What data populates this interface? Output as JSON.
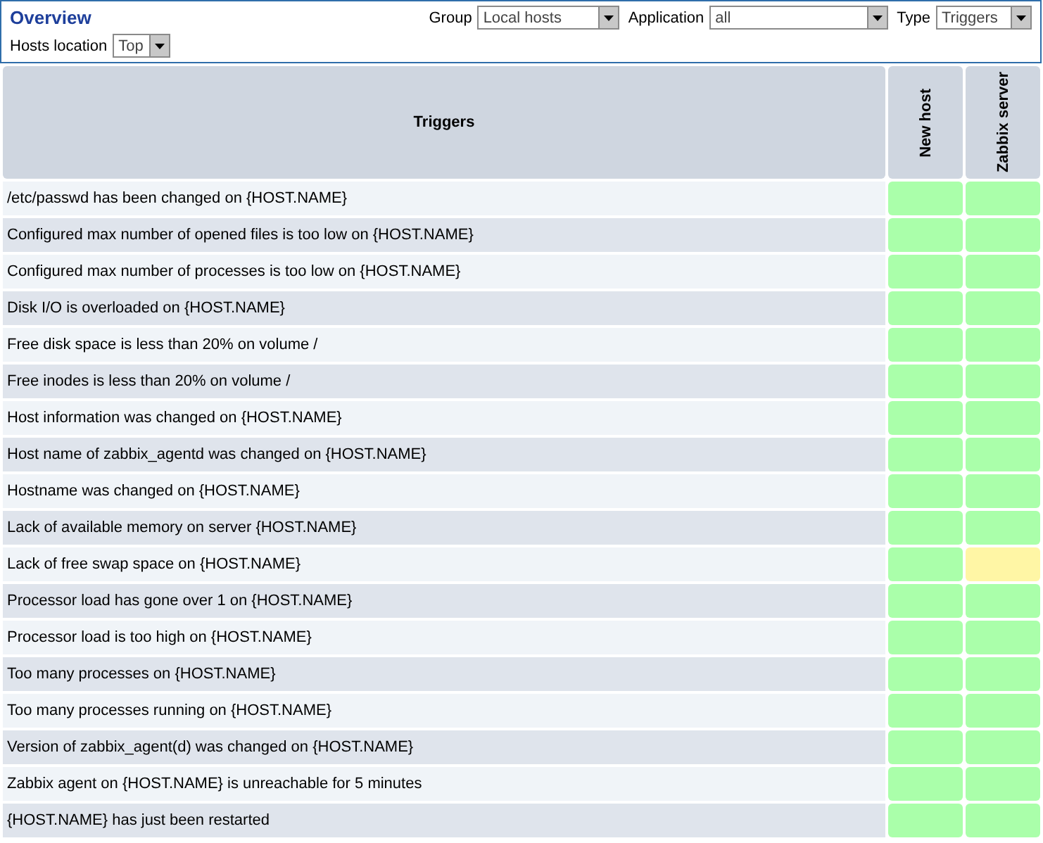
{
  "header": {
    "title": "Overview",
    "filters": [
      {
        "label": "Group",
        "value": "Local hosts"
      },
      {
        "label": "Application",
        "value": "all"
      },
      {
        "label": "Type",
        "value": "Triggers"
      }
    ],
    "second_filters": [
      {
        "label": "Hosts location",
        "value": "Top"
      }
    ]
  },
  "table": {
    "columns": [
      "Triggers",
      "New host",
      "Zabbix server"
    ],
    "rows": [
      {
        "trigger": "/etc/passwd has been changed on {HOST.NAME}",
        "cells": [
          {
            "color": "#aaffaa"
          },
          {
            "color": "#aaffaa"
          }
        ]
      },
      {
        "trigger": "Configured max number of opened files is too low on {HOST.NAME}",
        "cells": [
          {
            "color": "#aaffaa"
          },
          {
            "color": "#aaffaa"
          }
        ]
      },
      {
        "trigger": "Configured max number of processes is too low on {HOST.NAME}",
        "cells": [
          {
            "color": "#aaffaa"
          },
          {
            "color": "#aaffaa"
          }
        ]
      },
      {
        "trigger": "Disk I/O is overloaded on {HOST.NAME}",
        "cells": [
          {
            "color": "#aaffaa"
          },
          {
            "color": "#aaffaa"
          }
        ]
      },
      {
        "trigger": "Free disk space is less than 20% on volume /",
        "cells": [
          {
            "color": "#aaffaa"
          },
          {
            "color": "#aaffaa"
          }
        ]
      },
      {
        "trigger": "Free inodes is less than 20% on volume /",
        "cells": [
          {
            "color": "#aaffaa"
          },
          {
            "color": "#aaffaa"
          }
        ]
      },
      {
        "trigger": "Host information was changed on {HOST.NAME}",
        "cells": [
          {
            "color": "#aaffaa"
          },
          {
            "color": "#aaffaa"
          }
        ]
      },
      {
        "trigger": "Host name of zabbix_agentd was changed on {HOST.NAME}",
        "cells": [
          {
            "color": "#aaffaa"
          },
          {
            "color": "#aaffaa"
          }
        ]
      },
      {
        "trigger": "Hostname was changed on {HOST.NAME}",
        "cells": [
          {
            "color": "#aaffaa"
          },
          {
            "color": "#aaffaa"
          }
        ]
      },
      {
        "trigger": "Lack of available memory on server {HOST.NAME}",
        "cells": [
          {
            "color": "#aaffaa"
          },
          {
            "color": "#aaffaa"
          }
        ]
      },
      {
        "trigger": "Lack of free swap space on {HOST.NAME}",
        "cells": [
          {
            "color": "#aaffaa"
          },
          {
            "color": "#fff6a5"
          }
        ]
      },
      {
        "trigger": "Processor load has gone over 1 on {HOST.NAME}",
        "cells": [
          {
            "color": "#aaffaa"
          },
          {
            "color": "#aaffaa"
          }
        ]
      },
      {
        "trigger": "Processor load is too high on {HOST.NAME}",
        "cells": [
          {
            "color": "#aaffaa"
          },
          {
            "color": "#aaffaa"
          }
        ]
      },
      {
        "trigger": "Too many processes on {HOST.NAME}",
        "cells": [
          {
            "color": "#aaffaa"
          },
          {
            "color": "#aaffaa"
          }
        ]
      },
      {
        "trigger": "Too many processes running on {HOST.NAME}",
        "cells": [
          {
            "color": "#aaffaa"
          },
          {
            "color": "#aaffaa"
          }
        ]
      },
      {
        "trigger": "Version of zabbix_agent(d) was changed on {HOST.NAME}",
        "cells": [
          {
            "color": "#aaffaa"
          },
          {
            "color": "#aaffaa"
          }
        ]
      },
      {
        "trigger": "Zabbix agent on {HOST.NAME} is unreachable for 5 minutes",
        "cells": [
          {
            "color": "#aaffaa"
          },
          {
            "color": "#aaffaa"
          }
        ]
      },
      {
        "trigger": "{HOST.NAME} has just been restarted",
        "cells": [
          {
            "color": "#aaffaa"
          },
          {
            "color": "#aaffaa"
          }
        ]
      }
    ]
  }
}
